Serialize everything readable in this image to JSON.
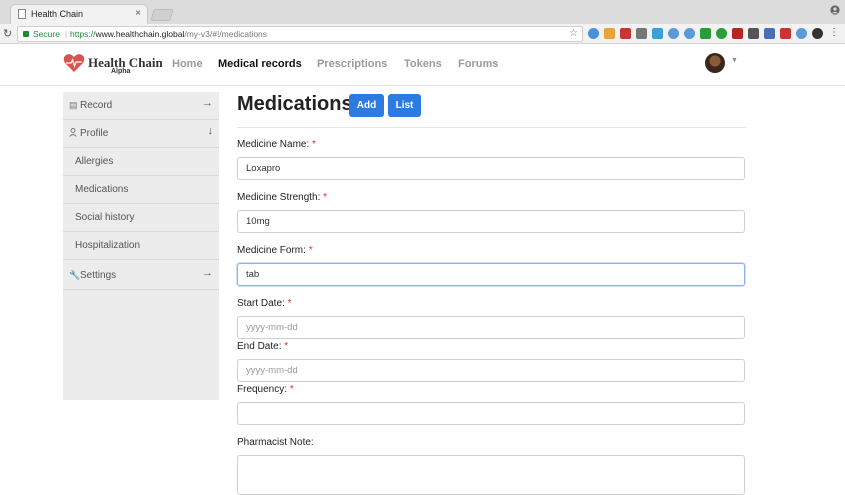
{
  "browser": {
    "tab_title": "Health Chain",
    "tab_close": "×",
    "secure_label": "Secure",
    "url_scheme": "https://",
    "url_host": "www.healthchain.global",
    "url_path": "/my-v3/#!/medications"
  },
  "navbar": {
    "brand": "Health Chain",
    "brand_sub": "Alpha",
    "links": [
      "Home",
      "Medical records",
      "Prescriptions",
      "Tokens",
      "Forums"
    ],
    "active_link": "Medical records"
  },
  "sidebar": {
    "items": [
      {
        "label": "Record",
        "arrow": "→"
      },
      {
        "label": "Profile",
        "arrow": "↓"
      },
      {
        "label": "Allergies"
      },
      {
        "label": "Medications"
      },
      {
        "label": "Social history"
      },
      {
        "label": "Hospitalization"
      },
      {
        "label": "Settings",
        "arrow": "→"
      }
    ]
  },
  "main": {
    "title": "Medications",
    "add_button": "Add",
    "list_button": "List",
    "fields": [
      {
        "label": "Medicine Name:",
        "required": "*",
        "value": "Loxapro"
      },
      {
        "label": "Medicine Strength:",
        "required": "*",
        "value": "10mg"
      },
      {
        "label": "Medicine Form:",
        "required": "*",
        "value": "tab"
      },
      {
        "label": "Start Date:",
        "required": "*",
        "placeholder": "yyyy-mm-dd"
      },
      {
        "label": "End Date:",
        "required": "*",
        "placeholder": "yyyy-mm-dd"
      },
      {
        "label": "Frequency:",
        "required": "*",
        "value": ""
      },
      {
        "label": "Pharmacist Note:",
        "required": ""
      }
    ]
  },
  "colors": {
    "primary_button": "#2d7be0",
    "required_star": "#d9302c",
    "secure_green": "#1d8a3a"
  }
}
